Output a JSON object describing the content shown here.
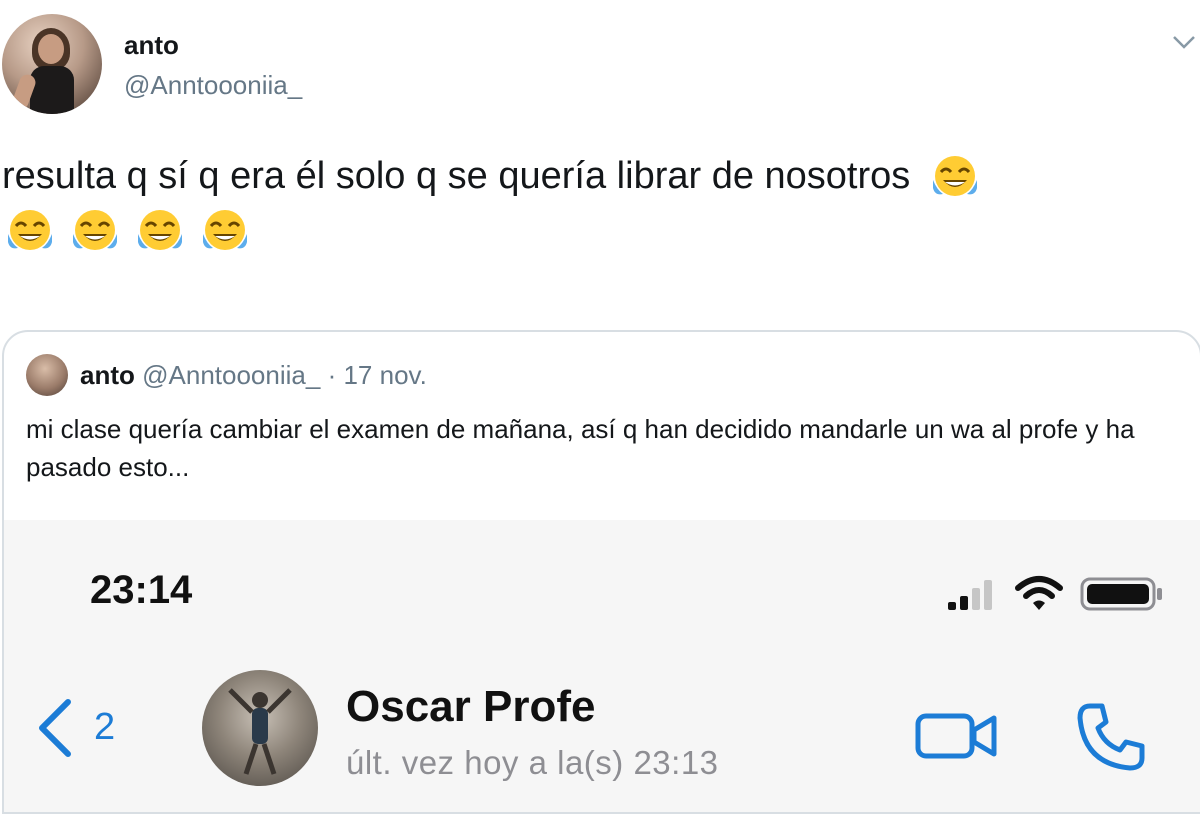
{
  "tweet": {
    "display_name": "anto",
    "handle": "@Anntoooniia_",
    "text": "resulta q sí q era él solo q se quería librar de nosotros",
    "emoji_name": "face-with-tears-of-joy"
  },
  "quoted_tweet": {
    "display_name": "anto",
    "handle": "@Anntoooniia_",
    "separator": "·",
    "date": "17 nov.",
    "text": "mi clase quería cambiar el examen de mañana, así q han decidido mandarle un wa al profe y ha pasado esto..."
  },
  "whatsapp": {
    "status_time": "23:14",
    "back_count": "2",
    "contact_name": "Oscar Profe",
    "last_seen": "últ. vez hoy a la(s) 23:13",
    "accent_color": "#1c7cd6"
  },
  "icons": {
    "caret": "chevron-down-icon",
    "signal": "signal-bars-icon",
    "wifi": "wifi-icon",
    "battery": "battery-icon",
    "back": "chevron-left-icon",
    "video": "video-call-icon",
    "phone": "phone-call-icon"
  },
  "colors": {
    "text": "#14171a",
    "secondary": "#657786",
    "border": "#d8dee3"
  }
}
